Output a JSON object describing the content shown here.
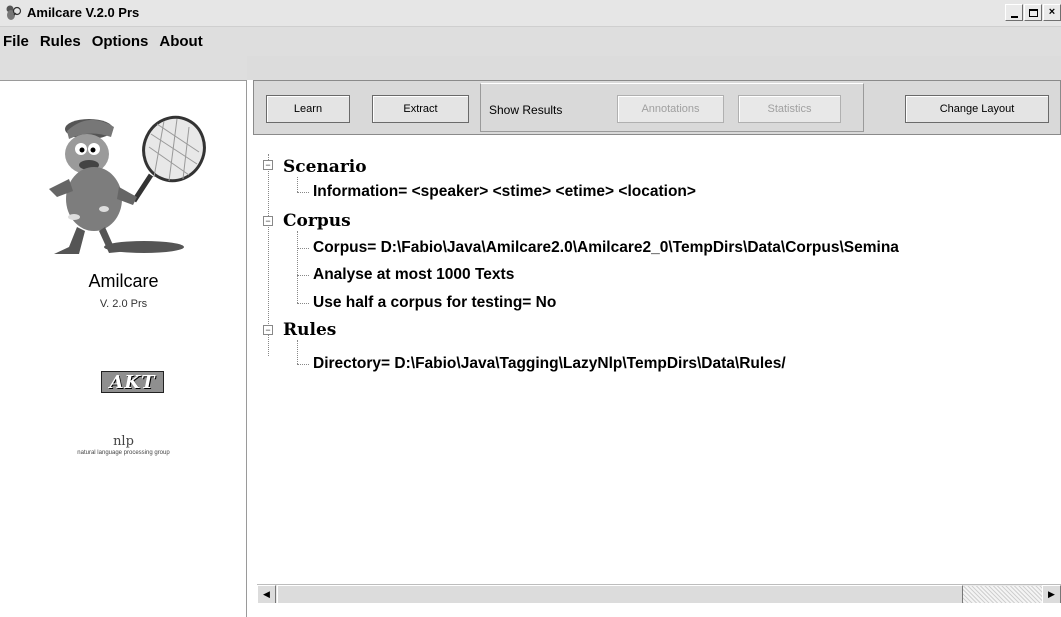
{
  "window": {
    "title": "Amilcare V.2.0 Prs",
    "controls": {
      "minimize": "_",
      "maximize": "□",
      "close": "×"
    }
  },
  "menu": [
    "File",
    "Rules",
    "Options",
    "About"
  ],
  "sidebar": {
    "name": "Amilcare",
    "version": "V. 2.0 Prs",
    "akt_logo": "AKT",
    "nlp_logo_main": "nlp",
    "nlp_logo_sub": "natural language processing group"
  },
  "toolbar": {
    "learn": "Learn",
    "extract": "Extract",
    "show_results": "Show Results",
    "annotations": "Annotations",
    "statistics": "Statistics",
    "change_layout": "Change Layout"
  },
  "tree": {
    "scenario": {
      "label": "Scenario",
      "items": [
        "Information=  <speaker> <stime> <etime> <location>"
      ]
    },
    "corpus": {
      "label": "Corpus",
      "items": [
        "Corpus= D:\\Fabio\\Java\\Amilcare2.0\\Amilcare2_0\\TempDirs\\Data\\Corpus\\Semina",
        "Analyse at most 1000  Texts",
        "Use half a corpus for testing= No"
      ]
    },
    "rules": {
      "label": "Rules",
      "items": [
        "Directory= D:\\Fabio\\Java\\Tagging\\LazyNlp\\TempDirs\\Data\\Rules/"
      ]
    }
  },
  "scrollbar": {
    "left_arrow": "◀",
    "right_arrow": "▶"
  }
}
